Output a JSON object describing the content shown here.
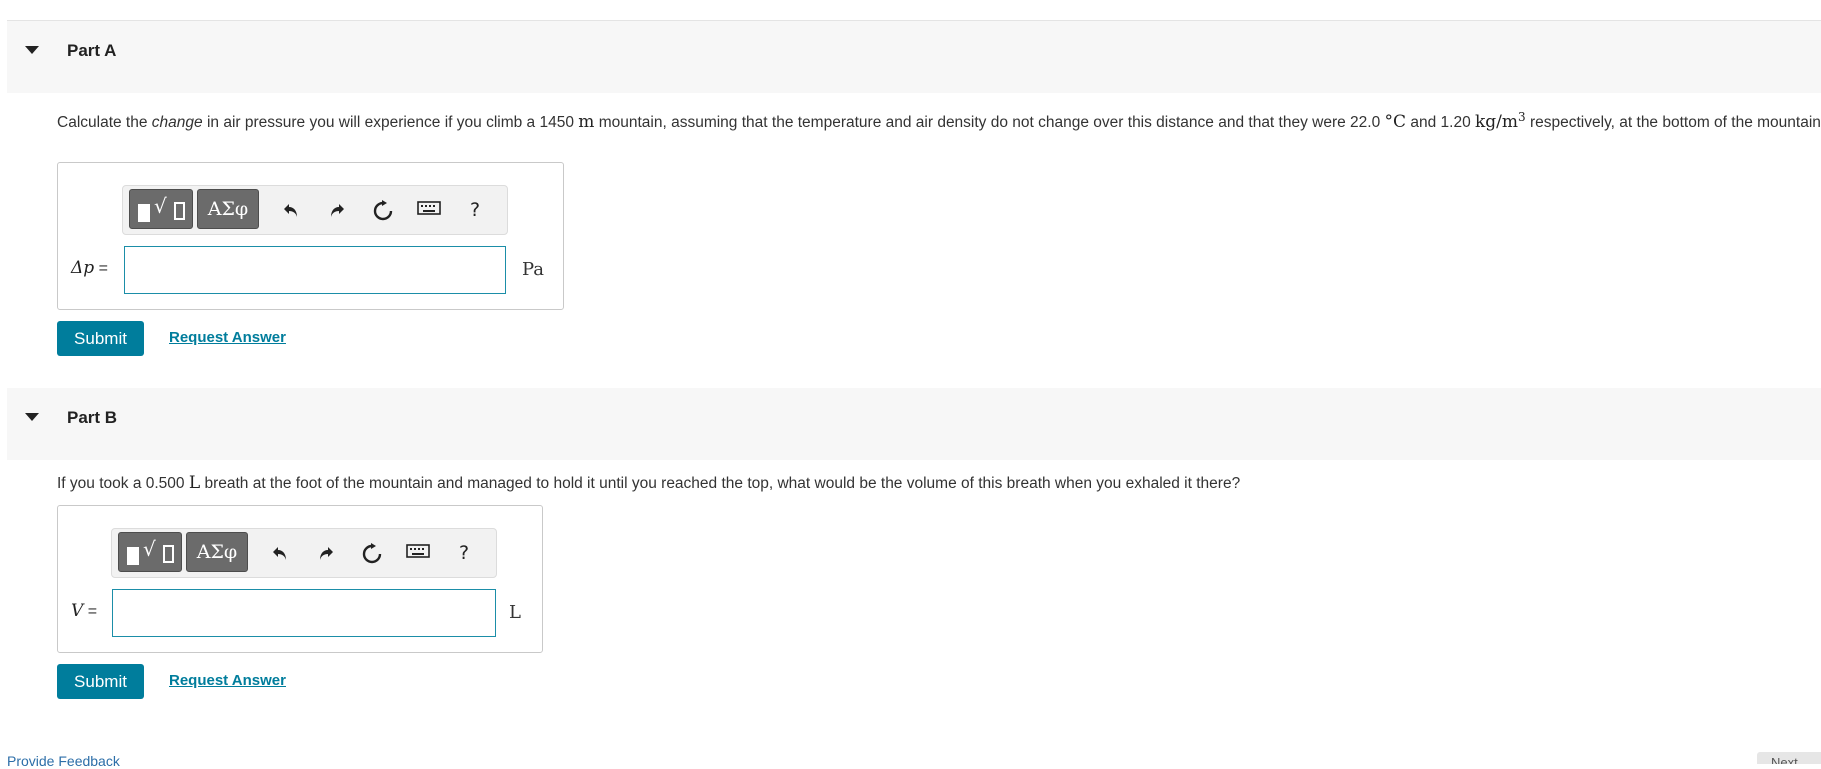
{
  "colors": {
    "accent": "#007d9c",
    "input_border": "#1b8ea8",
    "header_bg": "#f7f7f7",
    "toolbar_button": "#6b6b6b"
  },
  "part_a": {
    "title": "Part A",
    "question": {
      "t1": "Calculate the ",
      "em": "change",
      "t2": " in air pressure you will experience if you climb a 1450 ",
      "m": "m",
      "t3": " mountain, assuming that the temperature and air density do not change over this distance and that they were 22.0 ",
      "degC": "°C",
      "t4": " and 1.20 ",
      "density_unit": "kg/m",
      "exp": "3",
      "t5": " respectively, at the bottom of the mountain."
    },
    "toolbar": {
      "symbols_label": "ΑΣφ",
      "help_label": "?",
      "icons": [
        "templates-icon",
        "undo-icon",
        "redo-icon",
        "reset-icon",
        "keyboard-icon",
        "help-icon"
      ]
    },
    "variable": "Δp",
    "equals": "=",
    "input_value": "",
    "unit": "Pa",
    "submit_label": "Submit",
    "request_label": "Request Answer"
  },
  "part_b": {
    "title": "Part B",
    "question": {
      "t1": "If you took a 0.500 ",
      "L": "L",
      "t2": " breath at the foot of the mountain and managed to hold it until you reached the top, what would be the volume of this breath when you exhaled it there?"
    },
    "toolbar": {
      "symbols_label": "ΑΣφ",
      "help_label": "?",
      "icons": [
        "templates-icon",
        "undo-icon",
        "redo-icon",
        "reset-icon",
        "keyboard-icon",
        "help-icon"
      ]
    },
    "variable": "V",
    "equals": "=",
    "input_value": "",
    "unit": "L",
    "submit_label": "Submit",
    "request_label": "Request Answer"
  },
  "footer": {
    "feedback_label": "Provide Feedback",
    "next_label": "Next"
  }
}
